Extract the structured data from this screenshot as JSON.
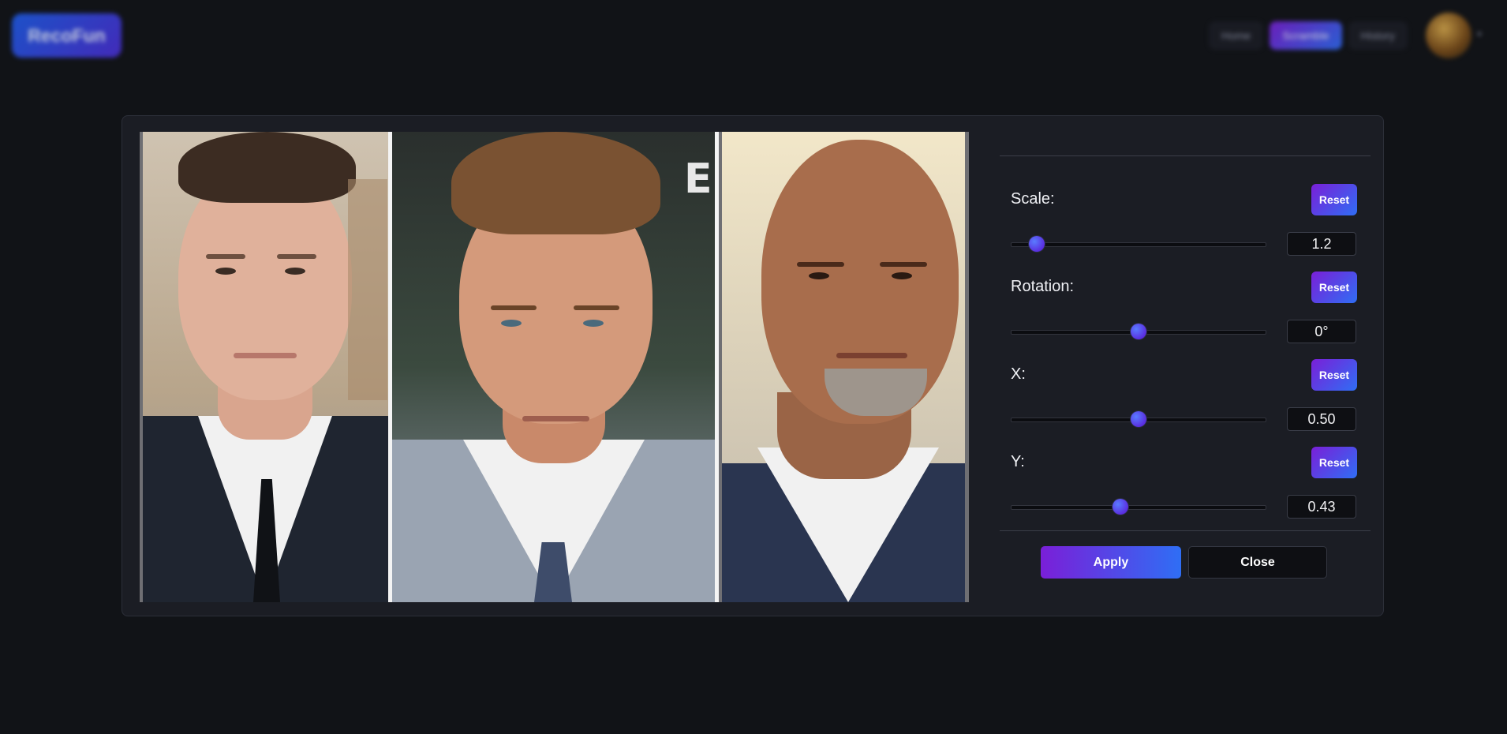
{
  "header": {
    "logo_text": "RecoFun",
    "nav": [
      {
        "label": "Home"
      },
      {
        "label": "Scramble"
      },
      {
        "label": "History"
      }
    ],
    "avatar_icon": "user-avatar"
  },
  "modal": {
    "controls": [
      {
        "label": "Scale:",
        "reset_label": "Reset",
        "value": "1.2",
        "slider_fraction": 0.1
      },
      {
        "label": "Rotation:",
        "reset_label": "Reset",
        "value": "0°",
        "slider_fraction": 0.5
      },
      {
        "label": "X:",
        "reset_label": "Reset",
        "value": "0.50",
        "slider_fraction": 0.5
      },
      {
        "label": "Y:",
        "reset_label": "Reset",
        "value": "0.43",
        "slider_fraction": 0.43
      }
    ],
    "apply_label": "Apply",
    "close_label": "Close",
    "preview_letter": "E"
  },
  "colors": {
    "background": "#111317",
    "modal_bg": "#1b1d24",
    "accent_start": "#7a1fd8",
    "accent_end": "#2f6ef5"
  }
}
